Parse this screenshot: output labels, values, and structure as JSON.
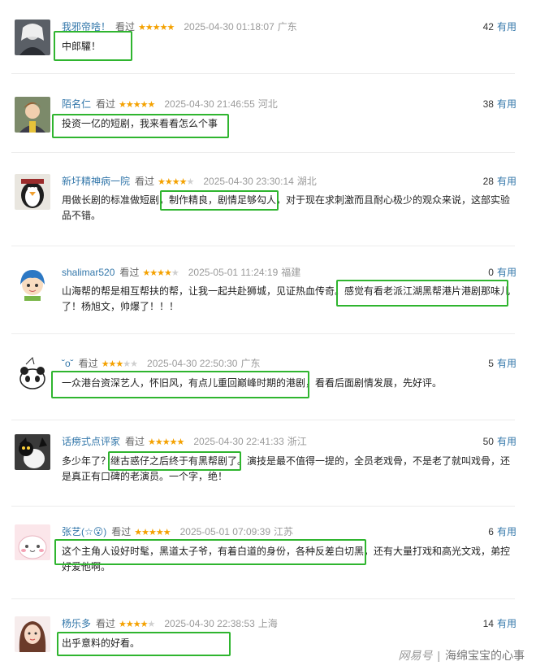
{
  "colors": {
    "user_link": "#3377aa",
    "star_on": "#f4a100",
    "star_off": "#cfcfcf",
    "highlight_box": "#2fb52f",
    "meta_gray": "#9a9a9a"
  },
  "reviews": [
    {
      "user": "我邪帝啥！",
      "status": "看过",
      "stars": 5,
      "stars_text": "★★★★★",
      "stars_off_text": "",
      "time": "2025-04-30 01:18:07",
      "location": "广东",
      "votes": "42",
      "useful_label": "有用",
      "content_before": "",
      "content_highlight": "中郎驩！",
      "content_after": ""
    },
    {
      "user": "陌名仁",
      "status": "看过",
      "stars": 5,
      "stars_text": "★★★★★",
      "stars_off_text": "",
      "time": "2025-04-30 21:46:55",
      "location": "河北",
      "votes": "38",
      "useful_label": "有用",
      "content_before": "",
      "content_highlight": "投资一亿的短剧，我来看看怎么个事",
      "content_after": ""
    },
    {
      "user": "新圩精神病一院",
      "status": "看过",
      "stars": 4,
      "stars_text": "★★★★",
      "stars_off_text": "★",
      "time": "2025-04-30 23:30:14",
      "location": "湖北",
      "votes": "28",
      "useful_label": "有用",
      "content_before": "用做长剧的标准做短剧，",
      "content_highlight": "制作精良，剧情足够勾人",
      "content_after": "，对于现在求刺激而且耐心极少的观众来说，这部实验品不错。"
    },
    {
      "user": "shalimar520",
      "status": "看过",
      "stars": 4,
      "stars_text": "★★★★",
      "stars_off_text": "★",
      "time": "2025-05-01 11:24:19",
      "location": "福建",
      "votes": "0",
      "useful_label": "有用",
      "content_before": "山海帮的帮是相互帮扶的帮，让我一起共赴狮城，见证热血传奇。",
      "content_highlight": "感觉有看老派江湖黑帮港片港剧那味儿",
      "content_after": "了！杨旭文，帅爆了！！！"
    },
    {
      "user": "˘o˘",
      "status": "看过",
      "stars": 3,
      "stars_text": "★★★",
      "stars_off_text": "★★",
      "time": "2025-04-30 22:50:30",
      "location": "广东",
      "votes": "5",
      "useful_label": "有用",
      "content_before": "",
      "content_highlight": "一众港台资深艺人，怀旧风，有点儿重回巅峰时期的港剧",
      "content_after": "，看看后面剧情发展，先好评。"
    },
    {
      "user": "话痨式点评家",
      "status": "看过",
      "stars": 5,
      "stars_text": "★★★★★",
      "stars_off_text": "",
      "time": "2025-04-30 22:41:33",
      "location": "浙江",
      "votes": "50",
      "useful_label": "有用",
      "content_before": "多少年了？",
      "content_highlight": "继古惑仔之后终于有黑帮剧了。",
      "content_after": "演技是最不值得一提的，全员老戏骨，不是老了就叫戏骨，还是真正有口碑的老演员。一个字，绝！"
    },
    {
      "user": "张艺(☆😮)",
      "status": "看过",
      "stars": 5,
      "stars_text": "★★★★★",
      "stars_off_text": "",
      "time": "2025-05-01 07:09:39",
      "location": "江苏",
      "votes": "6",
      "useful_label": "有用",
      "content_before": "",
      "content_highlight": "这个主角人设好时髦，黑道太子爷，有着白道的身份，各种反差白切黑，",
      "content_after": "还有大量打戏和高光文戏，弟控好爱他啊。"
    },
    {
      "user": "杨乐多",
      "status": "看过",
      "stars": 4,
      "stars_text": "★★★★",
      "stars_off_text": "★",
      "time": "2025-04-30 22:38:53",
      "location": "上海",
      "votes": "14",
      "useful_label": "有用",
      "content_before": "",
      "content_highlight": "出乎意料的好看。",
      "content_after": ""
    }
  ],
  "watermark": {
    "brand": "网易号",
    "separator": "|",
    "account": "海绵宝宝的心事"
  }
}
